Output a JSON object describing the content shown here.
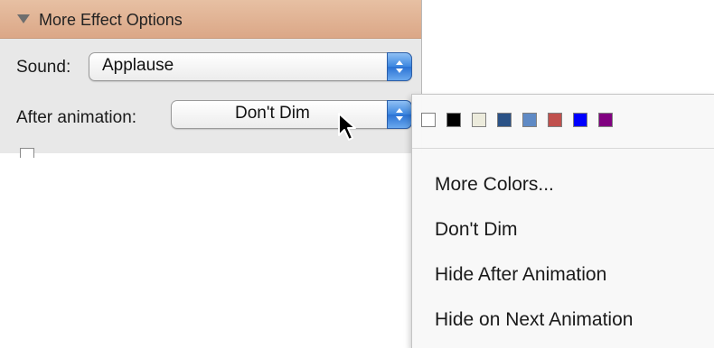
{
  "panel": {
    "header_title": "More Effect Options",
    "sound_label": "Sound:",
    "sound_value": "Applause",
    "after_label": "After animation:",
    "after_value": "Don't Dim"
  },
  "menu": {
    "swatches": [
      {
        "name": "white",
        "color": "#ffffff"
      },
      {
        "name": "black",
        "color": "#000000"
      },
      {
        "name": "beige",
        "color": "#ecebdc"
      },
      {
        "name": "dark-blue",
        "color": "#2b5286"
      },
      {
        "name": "light-blue",
        "color": "#5f8ac5"
      },
      {
        "name": "red",
        "color": "#c0504d"
      },
      {
        "name": "blue",
        "color": "#0000ff"
      },
      {
        "name": "purple",
        "color": "#800080"
      }
    ],
    "items": [
      "More Colors...",
      "Don't Dim",
      "Hide After Animation",
      "Hide on Next Animation"
    ]
  },
  "colors": {
    "header_bg": "#dba787",
    "stepper_blue": "#3c86e0",
    "panel_bg": "#e8e8e8"
  }
}
